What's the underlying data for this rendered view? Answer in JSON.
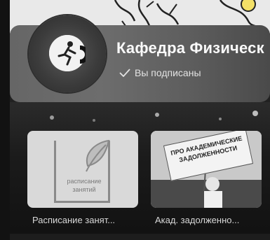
{
  "profile": {
    "title": "Кафедра Физическ",
    "subscription_status": "Вы подписаны",
    "avatar_icon": "runner-logo-icon",
    "check_icon": "checkmark-icon"
  },
  "tiles": [
    {
      "label": "Расписание занят...",
      "image_caption": "расписание занятий",
      "icon": "leaf-icon"
    },
    {
      "label": "Акад. задолженно...",
      "image_caption": "ПРО АКАДЕМИЧЕСКИЕ ЗАДОЛЖЕННОСТИ"
    }
  ],
  "colors": {
    "card_bg": "#666666",
    "title": "#fafafa",
    "subtitle": "#e3e3e3",
    "tile_label": "#d8d8d8"
  }
}
